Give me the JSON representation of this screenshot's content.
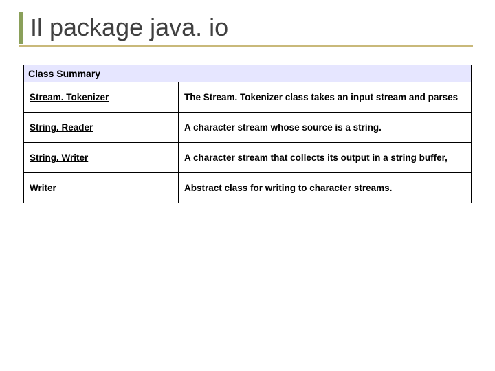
{
  "title": "Il package java. io",
  "table": {
    "header": "Class Summary",
    "rows": [
      {
        "class_name": "Stream. Tokenizer",
        "description": "The Stream. Tokenizer class takes an input stream and parses"
      },
      {
        "class_name": "String. Reader",
        "description": "A character stream whose source is a string."
      },
      {
        "class_name": "String. Writer",
        "description": "A character stream that collects its output in a string buffer,"
      },
      {
        "class_name": "Writer",
        "description": "Abstract class for writing to character streams."
      }
    ]
  }
}
